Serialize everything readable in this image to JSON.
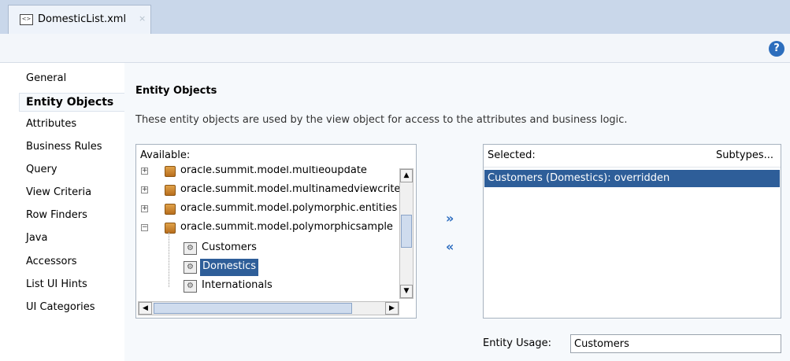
{
  "tab": {
    "title": "DomesticList.xml",
    "close": "×",
    "icon": "xml-file-icon"
  },
  "help": {
    "label": "?",
    "icon": "help-icon"
  },
  "nav": {
    "items": [
      {
        "label": "General"
      },
      {
        "label": "Entity Objects",
        "selected": true
      },
      {
        "label": "Attributes"
      },
      {
        "label": "Business Rules"
      },
      {
        "label": "Query"
      },
      {
        "label": "View Criteria"
      },
      {
        "label": "Row Finders"
      },
      {
        "label": "Java"
      },
      {
        "label": "Accessors"
      },
      {
        "label": "List UI Hints"
      },
      {
        "label": "UI Categories"
      }
    ]
  },
  "section": {
    "title": "Entity Objects",
    "description": "These entity objects are used by the view object for access to the attributes and business logic."
  },
  "available": {
    "label": "Available:",
    "tree": [
      {
        "label": "oracle.summit.model.multieoupdate",
        "type": "package",
        "expander": "+"
      },
      {
        "label": "oracle.summit.model.multinamedviewcriter",
        "type": "package",
        "expander": "+"
      },
      {
        "label": "oracle.summit.model.polymorphic.entities",
        "type": "package",
        "expander": "+"
      },
      {
        "label": "oracle.summit.model.polymorphicsample",
        "type": "package",
        "expander": "−"
      },
      {
        "label": "Customers",
        "type": "entity"
      },
      {
        "label": "Domestics",
        "type": "entity",
        "selected": true
      },
      {
        "label": "Internationals",
        "type": "entity"
      }
    ]
  },
  "move": {
    "add": "»",
    "remove": "«"
  },
  "selected": {
    "label": "Selected:",
    "subtypes": "Subtypes...",
    "items": [
      "Customers (Domestics): overridden"
    ]
  },
  "entity_usage": {
    "label": "Entity Usage:",
    "value": "Customers"
  },
  "colors": {
    "accent": "#2e5e99",
    "tabbar": "#c9d7ea",
    "panel_bg": "#f6f9fc"
  }
}
